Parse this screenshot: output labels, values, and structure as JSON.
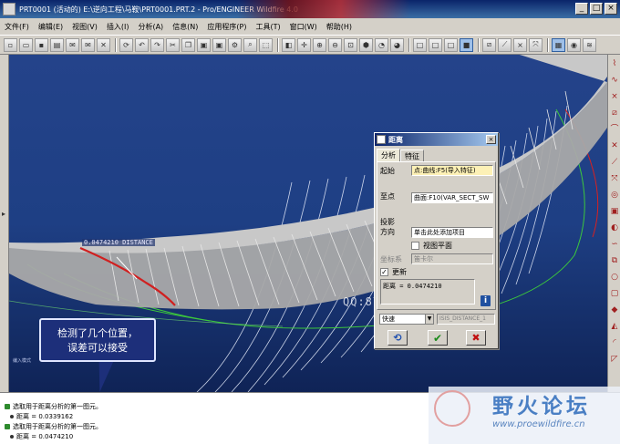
{
  "window": {
    "title": "PRT0001 (活动的) E:\\逆向工程\\马鞍\\PRT0001.PRT.2 - Pro/ENGINEER Wildfire 4.0",
    "min_label": "_",
    "max_label": "□",
    "close_label": "×"
  },
  "menu": [
    "文件(F)",
    "编辑(E)",
    "视图(V)",
    "插入(I)",
    "分析(A)",
    "信息(N)",
    "应用程序(P)",
    "工具(T)",
    "窗口(W)",
    "帮助(H)"
  ],
  "viewport": {
    "distance_label": "0.0474210  DISTANCE",
    "watermark": "QQ:87573632",
    "small_label": "编入模式"
  },
  "callout": {
    "line1": "检测了几个位置，",
    "line2": "误差可以接受"
  },
  "dialog": {
    "title": "距离",
    "close_label": "×",
    "tabs": [
      "分析",
      "特征"
    ],
    "from_label": "起始",
    "from_value": "点:曲线:F5(导入特征)",
    "to_label": "至点",
    "to_value": "曲面:F10(VAR_SECT_SW",
    "projection_label_1": "投影",
    "projection_label_2": "方向",
    "projection_value": "单击此处添加项目",
    "view_plane_label": "视图平面",
    "csys_label": "坐标系",
    "csys_value": "笛卡尔",
    "update_label": "更新",
    "result": "距离 = 0.0474210",
    "mode_value": "快速",
    "feature_name": "ISIS_DISTANCE_1"
  },
  "messages": [
    "选取用于距离分析的第一图元。",
    "距离 = 0.0339162",
    "选取用于距离分析的第一图元。",
    "距离 = 0.0474210"
  ],
  "forum": {
    "title": "野火论坛",
    "url": "www.proewildfire.cn"
  },
  "colors": {
    "viewport_bg": "#1e3f84",
    "surface": "#b8b8b8",
    "curve_green": "#3cc83c",
    "distance_red": "#d02020",
    "callout_bg": "#1d2f7a"
  }
}
